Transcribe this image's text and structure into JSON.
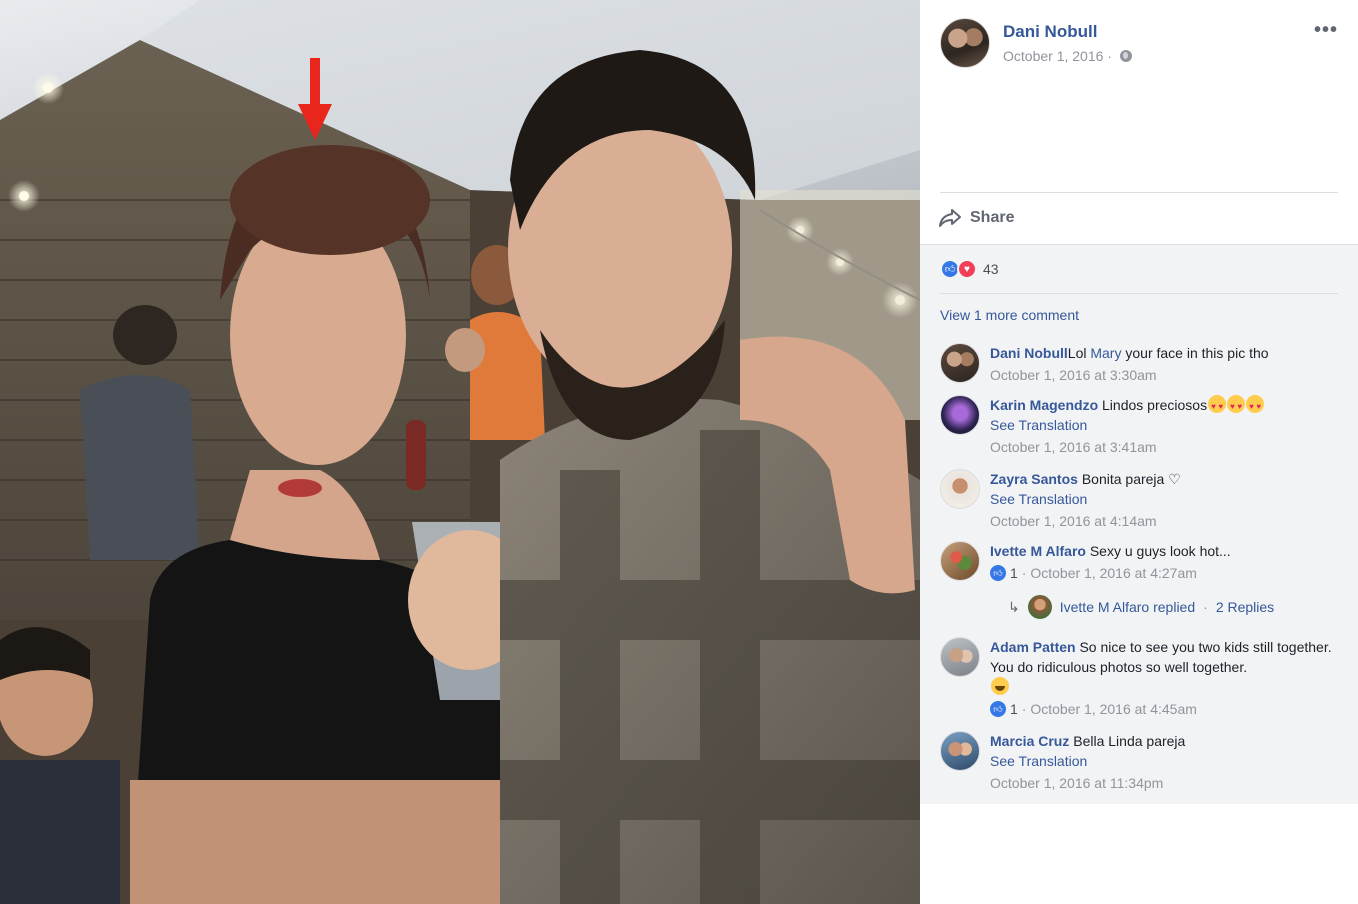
{
  "post": {
    "author": "Dani Nobull",
    "date": "October 1, 2016 ·",
    "privacy_icon": "globe-icon",
    "more_label": "•••",
    "share_label": "Share"
  },
  "reactions": {
    "types": [
      "like",
      "love"
    ],
    "count": "43"
  },
  "view_more_label": "View 1 more comment",
  "comments": [
    {
      "name": "Dani Nobull",
      "text": "Lol ",
      "mention": "Mary",
      "text_after": " your face in this pic tho",
      "time": "October 1, 2016 at 3:30am"
    },
    {
      "name": "Karin Magendzo",
      "text": " Lindos preciosos",
      "emoji": "heart-eyes x3",
      "see_translation": "See Translation",
      "time": "October 1, 2016 at 3:41am"
    },
    {
      "name": "Zayra Santos",
      "text": " Bonita pareja ♡",
      "see_translation": "See Translation",
      "time": "October 1, 2016 at 4:14am"
    },
    {
      "name": "Ivette M Alfaro",
      "text": " Sexy u guys look hot...",
      "likes": "1",
      "time": "· October 1, 2016 at 4:27am",
      "reply_summary": "Ivette M Alfaro replied",
      "reply_sep": "·",
      "reply_count": "2 Replies"
    },
    {
      "name": "Adam Patten",
      "text": " So nice to see you two kids still together. You do ridiculous photos so well together.",
      "emoji": "grin",
      "likes": "1",
      "time": "· October 1, 2016 at 4:45am"
    },
    {
      "name": "Marcia Cruz",
      "text": " Bella Linda pareja",
      "see_translation": "See Translation",
      "time": "October 1, 2016 at 11:34pm"
    }
  ],
  "colors": {
    "link": "#365899",
    "meta": "#90949c",
    "comments_bg": "#f2f3f5",
    "annotation_arrow": "#e8261c"
  }
}
